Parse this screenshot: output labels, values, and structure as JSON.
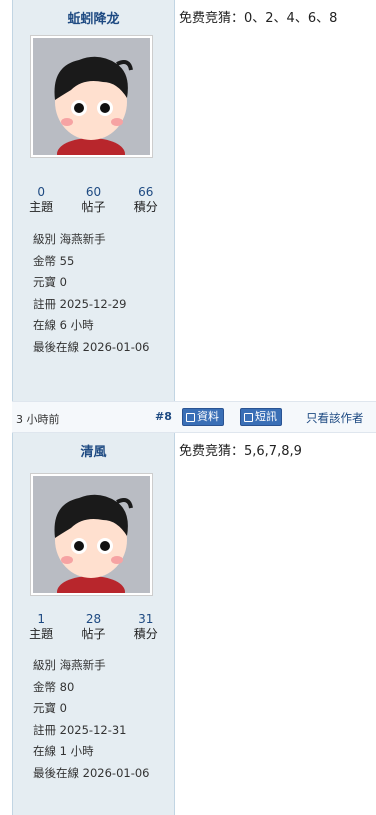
{
  "posts": [
    {
      "author": "蚯蚓降龙",
      "stats": [
        {
          "num": "0",
          "label": "主題"
        },
        {
          "num": "60",
          "label": "帖子"
        },
        {
          "num": "66",
          "label": "積分"
        }
      ],
      "info": [
        "級別 海燕新手",
        "金幣 55",
        "元寶 0",
        "註冊 2025-12-29",
        "在線 6 小時",
        "最後在線 2026-01-06"
      ],
      "message": "免费竞猜：0、2、4、6、8"
    },
    {
      "author": "清風",
      "stats": [
        {
          "num": "1",
          "label": "主題"
        },
        {
          "num": "28",
          "label": "帖子"
        },
        {
          "num": "31",
          "label": "積分"
        }
      ],
      "info": [
        "級別 海燕新手",
        "金幣 80",
        "元寶 0",
        "註冊 2025-12-31",
        "在線 1 小時",
        "最後在線 2026-01-06"
      ],
      "message": "免费竞猜：5,6,7,8,9"
    }
  ],
  "post_bar": {
    "time": "3 小時前",
    "floor": "#8",
    "profile_button": "資料",
    "pm_button": "短訊",
    "author_only": "只看該作者"
  },
  "colors": {
    "side_bg": "#e5edf2",
    "accent": "#1e4a82",
    "button": "#3a6fb6"
  }
}
